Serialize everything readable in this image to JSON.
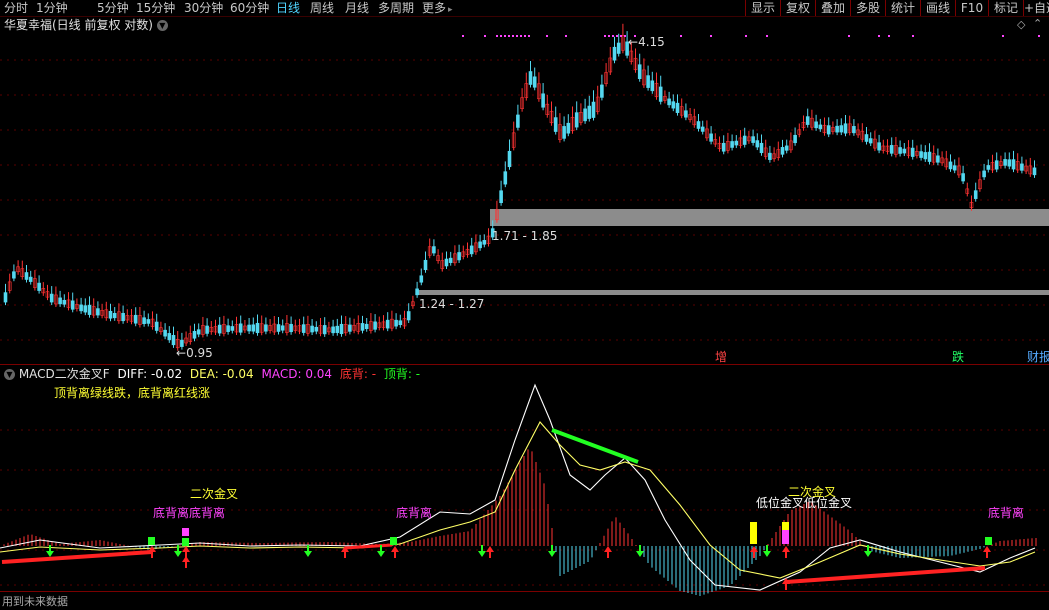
{
  "toolbar": {
    "timeframes": [
      {
        "label": "分时",
        "active": false
      },
      {
        "label": "1分钟",
        "active": false
      },
      {
        "label": "5分钟",
        "active": false
      },
      {
        "label": "15分钟",
        "active": false
      },
      {
        "label": "30分钟",
        "active": false
      },
      {
        "label": "60分钟",
        "active": false
      },
      {
        "label": "日线",
        "active": true
      },
      {
        "label": "周线",
        "active": false
      },
      {
        "label": "月线",
        "active": false
      },
      {
        "label": "多周期",
        "active": false
      },
      {
        "label": "更多",
        "active": false
      }
    ],
    "right_buttons": [
      "显示",
      "复权",
      "叠加",
      "多股",
      "统计",
      "画线",
      "F10",
      "标记",
      "+自选"
    ]
  },
  "main_chart": {
    "title": "华夏幸福(日线 前复权 对数)",
    "price_high_label": "4.15",
    "price_low_label": "0.95",
    "zone_upper_label": "1.71 - 1.85",
    "zone_lower_label": "1.24 - 1.27",
    "event_markers": [
      {
        "label": "增",
        "color": "#ff4444"
      },
      {
        "label": "跌",
        "color": "#22ff66"
      },
      {
        "label": "财报",
        "color": "#55aaff"
      }
    ]
  },
  "indicator": {
    "name": "MACD二次金叉F",
    "diff": "DIFF: -0.02",
    "dea": "DEA: -0.04",
    "macd": "MACD: 0.04",
    "dibei": "底背: -",
    "dingbei": "顶背: -",
    "note": "顶背离绿线跌，底背离红线涨",
    "annotations": {
      "second_cross_left": "二次金叉",
      "bottom_div_left": "底背离底背离",
      "bottom_div_mid": "底背离",
      "second_cross_right": "二次金叉",
      "low_cross_right": "低位金叉低位金叉",
      "bottom_div_right": "底背离"
    },
    "colors": {
      "up": "#ff3333",
      "down": "#54d8f0",
      "diff": "#ffffff",
      "dea": "#ffff66",
      "macd": "#ff44ff",
      "green": "#22ff22",
      "yellow": "#ffff00"
    }
  },
  "footer": {
    "text": "用到未来数据"
  }
}
